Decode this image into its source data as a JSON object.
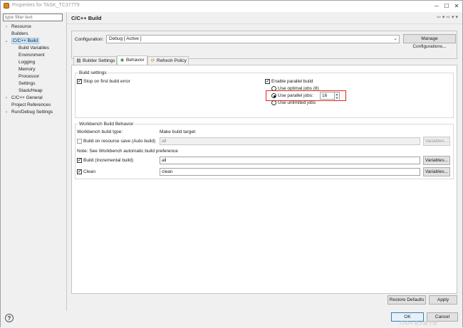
{
  "window": {
    "title": "Properties for TASK_TC377T9"
  },
  "window_buttons": {
    "minimize": "─",
    "maximize": "☐",
    "close": "✕"
  },
  "filter": {
    "placeholder": "type filter text"
  },
  "tree": {
    "items": [
      {
        "label": "Resource",
        "toggle": "›"
      },
      {
        "label": "Builders",
        "toggle": ""
      },
      {
        "label": "C/C++ Build",
        "toggle": "⌄"
      },
      {
        "label": "Build Variables",
        "toggle": ""
      },
      {
        "label": "Environment",
        "toggle": ""
      },
      {
        "label": "Logging",
        "toggle": ""
      },
      {
        "label": "Memory",
        "toggle": ""
      },
      {
        "label": "Processor",
        "toggle": ""
      },
      {
        "label": "Settings",
        "toggle": ""
      },
      {
        "label": "Stack/Heap",
        "toggle": ""
      },
      {
        "label": "C/C++ General",
        "toggle": "›"
      },
      {
        "label": "Project References",
        "toggle": ""
      },
      {
        "label": "Run/Debug Settings",
        "toggle": "›"
      }
    ]
  },
  "page": {
    "title": "C/C++ Build",
    "nav": "⇦ ▾  ⇨ ▾  ▾"
  },
  "config": {
    "label": "Configuration:",
    "value": "Debug  [ Active ]",
    "manage_button": "Manage Configurations..."
  },
  "tabs": [
    {
      "label": "Builder Settings",
      "icon": "▤"
    },
    {
      "label": "Behavior",
      "icon": "◉"
    },
    {
      "label": "Refresh Policy",
      "icon": "⟳"
    }
  ],
  "build_settings": {
    "group_label": "Build settings",
    "stop_on_first_error": "Stop on first build error",
    "enable_parallel": "Enable parallel build",
    "optimal_jobs": "Use optimal jobs (8)",
    "parallel_jobs": "Use parallel jobs:",
    "parallel_jobs_value": "16",
    "unlimited_jobs": "Use unlimited jobs"
  },
  "workbench": {
    "group_label": "Workbench Build Behavior",
    "type_header": "Workbench build type:",
    "target_header": "Make build target:",
    "auto_build_label": "Build on resource save (Auto build)",
    "auto_build_value": "all",
    "note": "Note: See Workbench automatic build preference",
    "incremental_label": "Build (Incremental build)",
    "incremental_value": "all",
    "clean_label": "Clean",
    "clean_value": "clean",
    "variables_button": "Variables..."
  },
  "footer": {
    "restore_defaults": "Restore Defaults",
    "apply": "Apply",
    "ok": "OK",
    "cancel": "Cancel",
    "help": "?",
    "watermark": "CSDN @大佬子辰"
  }
}
